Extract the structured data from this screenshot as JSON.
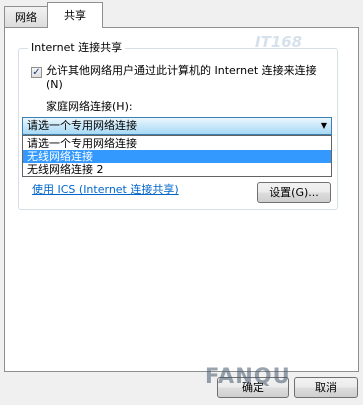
{
  "tabs": [
    {
      "label": "网络",
      "active": false
    },
    {
      "label": "共享",
      "active": true
    }
  ],
  "ics": {
    "group_title": "Internet 连接共享",
    "allow_label": "允许其他网络用户通过此计算机的 Internet 连接来连接(N)",
    "allow_checked": true,
    "home_label": "家庭网络连接(H):",
    "combo_value": "请选一个专用网络连接",
    "options": [
      "请选一个专用网络连接",
      "无线网络连接",
      "无线网络连接 2"
    ],
    "selected_option_index": 1,
    "second_checked": true,
    "link_text": "使用 ICS (Internet 连接共享)",
    "settings_label": "设置(G)..."
  },
  "footer": {
    "ok_label": "确定",
    "cancel_label": "取消"
  },
  "watermark": {
    "bottom": "FANQU",
    "top": "IT168"
  },
  "colors": {
    "accent": "#3399ff",
    "link": "#0066cc"
  }
}
